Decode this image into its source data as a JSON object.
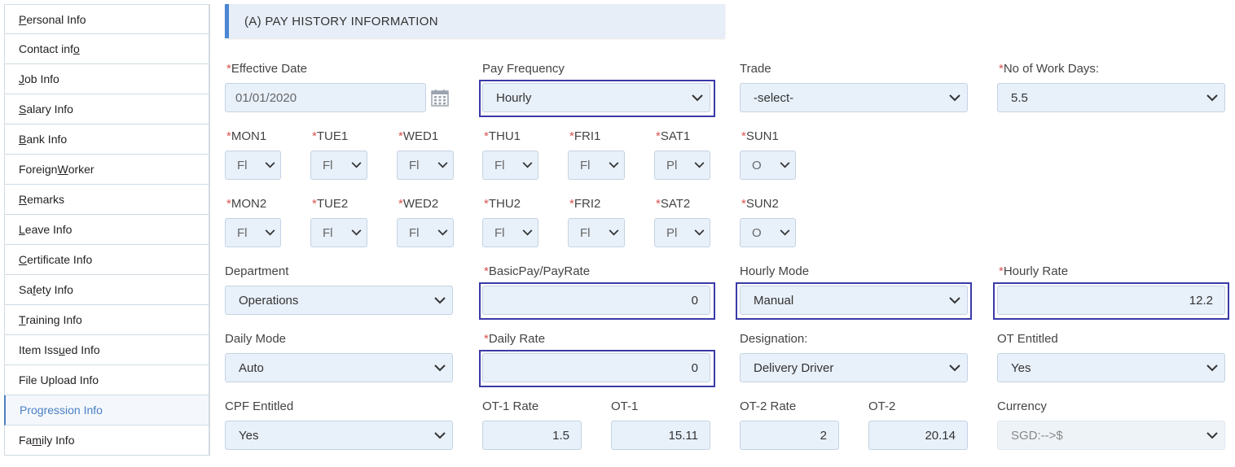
{
  "sidebar": {
    "items": [
      {
        "pre": "",
        "u": "P",
        "post": "ersonal Info"
      },
      {
        "pre": "Contact inf",
        "u": "o",
        "post": ""
      },
      {
        "pre": "",
        "u": "J",
        "post": "ob Info"
      },
      {
        "pre": "",
        "u": "S",
        "post": "alary Info"
      },
      {
        "pre": "",
        "u": "B",
        "post": "ank Info"
      },
      {
        "pre": "Foreign ",
        "u": "W",
        "post": "orker"
      },
      {
        "pre": "",
        "u": "R",
        "post": "emarks"
      },
      {
        "pre": "",
        "u": "L",
        "post": "eave Info"
      },
      {
        "pre": "",
        "u": "C",
        "post": "ertificate Info"
      },
      {
        "pre": "Sa",
        "u": "f",
        "post": "ety Info"
      },
      {
        "pre": "",
        "u": "T",
        "post": "raining Info"
      },
      {
        "pre": "Item Iss",
        "u": "u",
        "post": "ed Info"
      },
      {
        "pre": "File Upload Info",
        "u": "",
        "post": ""
      },
      {
        "pre": "Progression Info",
        "u": "",
        "post": ""
      },
      {
        "pre": "Fa",
        "u": "m",
        "post": "ily Info"
      }
    ]
  },
  "section": {
    "title": "(A) PAY HISTORY INFORMATION"
  },
  "form": {
    "effective_date": {
      "label": "Effective Date",
      "value": "01/01/2020"
    },
    "pay_frequency": {
      "label": "Pay Frequency",
      "value": "Hourly"
    },
    "trade": {
      "label": "Trade",
      "value": "-select-"
    },
    "work_days": {
      "label": "No of Work Days:",
      "value": "5.5"
    },
    "week1": [
      {
        "label": "MON1",
        "value": "Fl"
      },
      {
        "label": "TUE1",
        "value": "Fl"
      },
      {
        "label": "WED1",
        "value": "Fl"
      },
      {
        "label": "THU1",
        "value": "Fl"
      },
      {
        "label": "FRI1",
        "value": "Fl"
      },
      {
        "label": "SAT1",
        "value": "Pl"
      },
      {
        "label": "SUN1",
        "value": "O"
      }
    ],
    "week2": [
      {
        "label": "MON2",
        "value": "Fl"
      },
      {
        "label": "TUE2",
        "value": "Fl"
      },
      {
        "label": "WED2",
        "value": "Fl"
      },
      {
        "label": "THU2",
        "value": "Fl"
      },
      {
        "label": "FRI2",
        "value": "Fl"
      },
      {
        "label": "SAT2",
        "value": "Pl"
      },
      {
        "label": "SUN2",
        "value": "O"
      }
    ],
    "department": {
      "label": "Department",
      "value": "Operations"
    },
    "basic_pay": {
      "label": "BasicPay/PayRate",
      "value": "0"
    },
    "hourly_mode": {
      "label": "Hourly Mode",
      "value": "Manual"
    },
    "hourly_rate": {
      "label": "Hourly Rate",
      "value": "12.2"
    },
    "daily_mode": {
      "label": "Daily Mode",
      "value": "Auto"
    },
    "daily_rate": {
      "label": "Daily Rate",
      "value": "0"
    },
    "designation": {
      "label": "Designation:",
      "value": "Delivery Driver"
    },
    "ot_entitled": {
      "label": "OT Entitled",
      "value": "Yes"
    },
    "cpf_entitled": {
      "label": "CPF Entitled",
      "value": "Yes"
    },
    "ot1_rate": {
      "label": "OT-1 Rate",
      "value": "1.5"
    },
    "ot1": {
      "label": "OT-1",
      "value": "15.11"
    },
    "ot2_rate": {
      "label": "OT-2 Rate",
      "value": "2"
    },
    "ot2": {
      "label": "OT-2",
      "value": "20.14"
    },
    "currency": {
      "label": "Currency",
      "value": "SGD:-->$"
    }
  },
  "icons": {
    "calendar": "calendar-icon",
    "chevron": "chevron-down-icon"
  },
  "colors": {
    "accent": "#4a86d4",
    "highlight": "#3a3aa8",
    "required": "#d9534f",
    "field_bg": "#e8f0fa"
  }
}
